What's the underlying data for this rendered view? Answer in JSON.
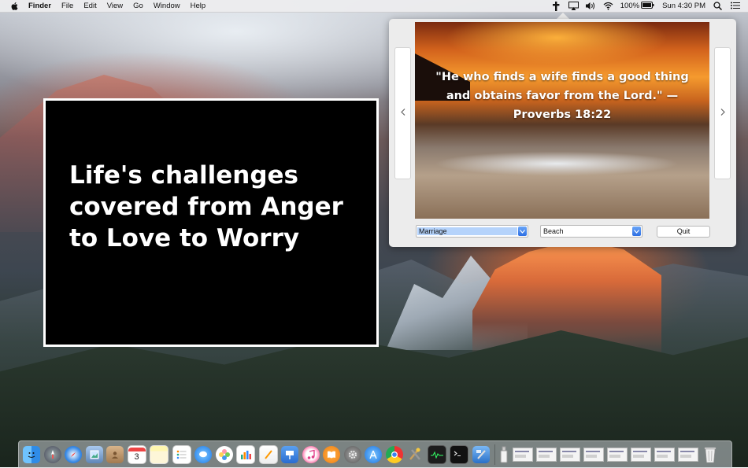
{
  "menubar": {
    "app_name": "Finder",
    "menus": [
      "File",
      "Edit",
      "View",
      "Go",
      "Window",
      "Help"
    ],
    "battery": "100%",
    "clock": "Sun 4:30 PM"
  },
  "popover": {
    "quote": "\"He who finds a wife finds a good thing and obtains favor from the Lord.\" — Proverbs 18:22",
    "topic_value": "Marriage",
    "background_value": "Beach",
    "quit_label": "Quit"
  },
  "promo": {
    "text": "Life's challenges covered from Anger to Love to Worry"
  },
  "dock": {
    "items": [
      "finder",
      "launchpad",
      "safari",
      "preview",
      "contacts",
      "calendar",
      "notes",
      "reminders",
      "messages",
      "photos",
      "numbers",
      "pages",
      "keynote",
      "itunes",
      "ibooks",
      "system-preferences",
      "app-store",
      "chrome",
      "utility",
      "activity-monitor",
      "terminal",
      "xcode"
    ],
    "calendar_day": "3"
  }
}
